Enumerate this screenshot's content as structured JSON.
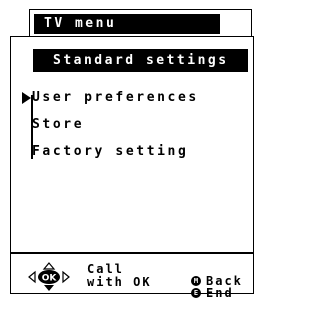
{
  "back_menu": {
    "title": "TV menu"
  },
  "front_menu": {
    "title": "Standard settings",
    "items": [
      {
        "label": "User preferences",
        "selected": true
      },
      {
        "label": "Store",
        "selected": false
      },
      {
        "label": "Factory setting",
        "selected": false
      }
    ]
  },
  "footer": {
    "ok_key": "OK",
    "call_line1": "Call",
    "call_line2": "with OK",
    "m_key": "M",
    "back_label": "Back",
    "e_key": "E",
    "end_label": "End"
  }
}
